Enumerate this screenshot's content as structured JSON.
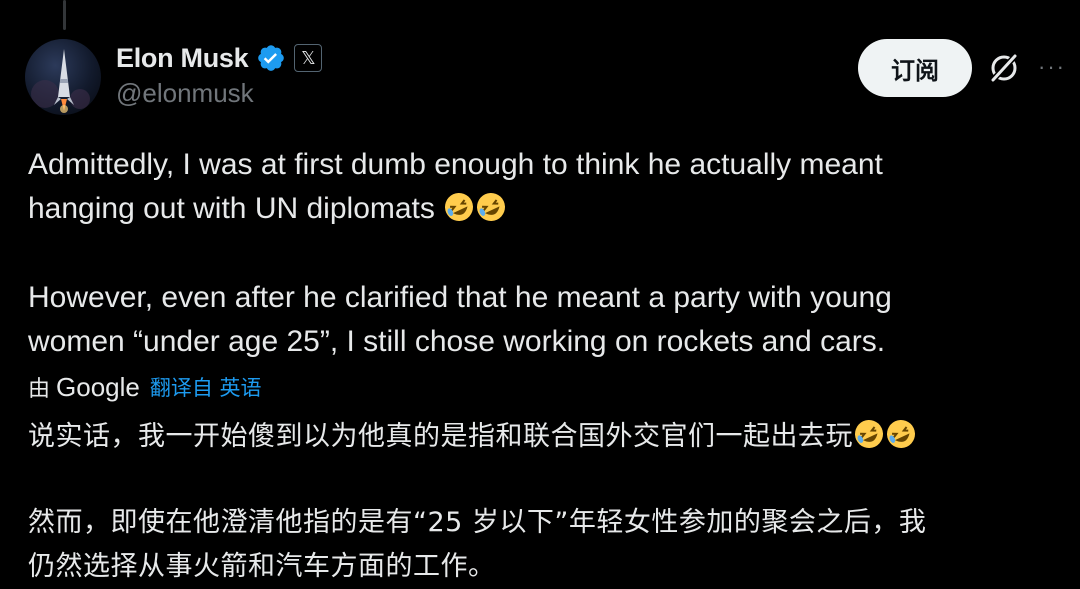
{
  "author": {
    "display_name": "Elon Musk",
    "handle": "@elonmusk",
    "affiliate_badge": "𝕏"
  },
  "actions": {
    "subscribe_label": "订阅",
    "more_label": "···"
  },
  "tweet": {
    "paragraph1_line1": "Admittedly, I was at first dumb enough to think he actually meant",
    "paragraph1_line2": "hanging out with UN diplomats",
    "paragraph2_line1": "However, even after he clarified that he meant a party with young",
    "paragraph2_line2": "women “under age 25”, I still chose working on rockets and cars."
  },
  "translation": {
    "by_label": "由",
    "provider": "Google",
    "link_label": "翻译自 英语",
    "zh_paragraph1": "说实话，我一开始傻到以为他真的是指和联合国外交官们一起出去玩",
    "zh_paragraph2_line1": "然而，即使在他澄清他指的是有“25 岁以下”年轻女性参加的聚会之后，我",
    "zh_paragraph2_line2": "仍然选择从事火箭和汽车方面的工作。"
  },
  "emoji_names": [
    "rolling-on-floor-laughing",
    "rolling-on-floor-laughing"
  ],
  "colors": {
    "background": "#000000",
    "text": "#e7e9ea",
    "secondary": "#71767b",
    "link": "#1d9bf0",
    "verified": "#1d9bf0",
    "button_bg": "#eff3f4"
  }
}
